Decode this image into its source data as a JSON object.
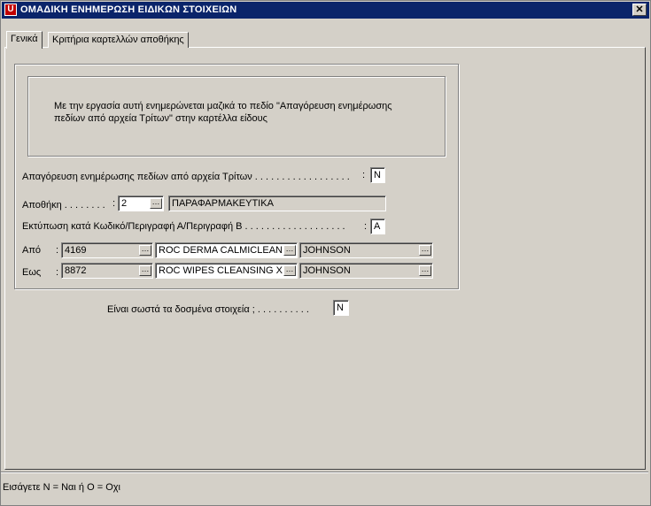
{
  "window": {
    "title": "ΟΜΑΔΙΚΗ ΕΝΗΜΕΡΩΣΗ ΕΙΔΙΚΩΝ ΣΤΟΙΧΕΙΩΝ",
    "app_icon_glyph": "U",
    "close_glyph": "✕"
  },
  "tabs": [
    {
      "label": "Γενικά",
      "active": true
    },
    {
      "label": "Κριτήρια καρτελλών αποθήκης",
      "active": false
    }
  ],
  "info": {
    "line1": "Με την εργασία αυτή ενημερώνεται μαζικά το πεδίο \"Απαγόρευση ενημέρωσης",
    "line2": "πεδίων από αρχεία Τρίτων\" στην καρτέλλα είδους"
  },
  "form": {
    "restrict": {
      "label": "Απαγόρευση ενημέρωσης πεδίων από αρχεία Τρίτων . . . . . . . . . . . . . . . . . .",
      "colon": ":",
      "value": "N"
    },
    "warehouse": {
      "label": "Αποθήκη . . . . . . . .",
      "colon": ":",
      "code": "2",
      "name": "ΠΑΡΑΦΑΡΜΑΚΕΥΤΙΚΑ"
    },
    "print_by": {
      "label": "Εκτύπωση κατά Κωδικό/Περιγραφή Α/Περιγραφή Β . . . . . . . . . . . . . . . . . . .",
      "colon": ":",
      "value": "A"
    },
    "from": {
      "label": "Από",
      "colon": ":",
      "code": "4169",
      "desc_a": "ROC  DERMA  CALMICLEAN",
      "desc_b": "JOHNSON"
    },
    "to": {
      "label": "Εως",
      "colon": ":",
      "code": "8872",
      "desc_a": "ROC WIPES CLEANSING X",
      "desc_b": "JOHNSON"
    },
    "confirm": {
      "label": "Είναι σωστά τα δοσμένα στοιχεία ; . . . . . . . . . .",
      "value": "N"
    }
  },
  "buttons": {
    "lookup_glyph": "…"
  },
  "status_bar": {
    "text": "Εισάγετε N = Ναι  ή  O = Οχι"
  }
}
